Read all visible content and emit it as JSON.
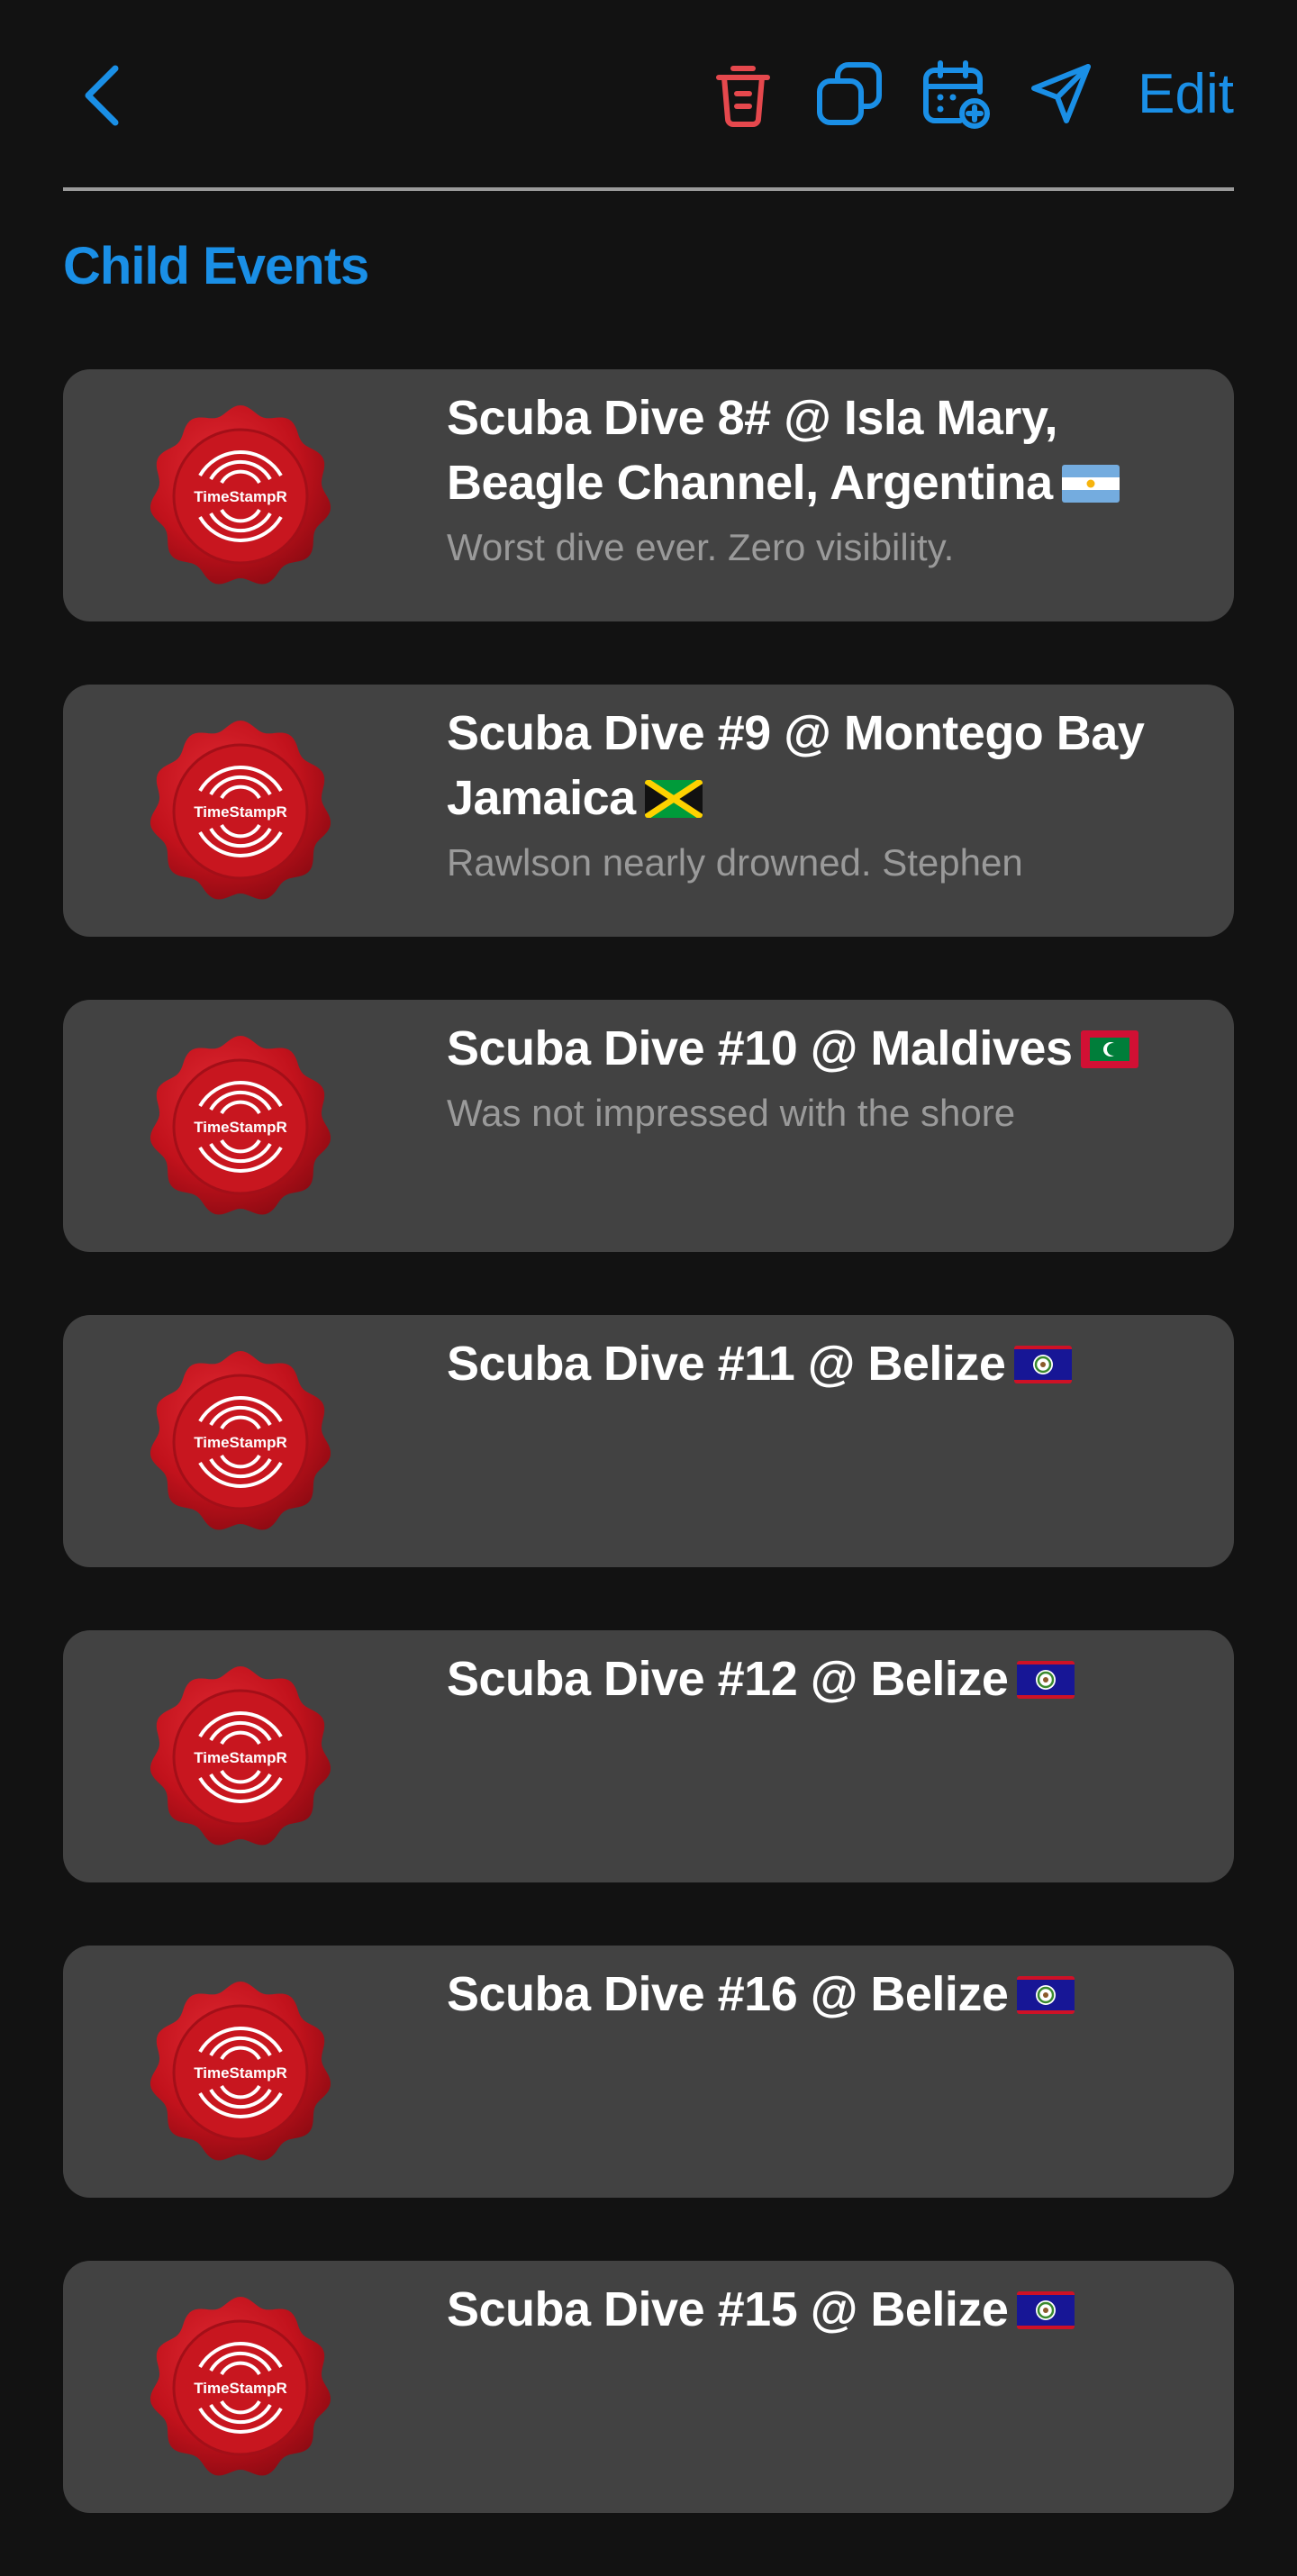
{
  "header": {
    "back_icon": "chevron-left-icon",
    "delete_icon": "trash-icon",
    "duplicate_icon": "copy-icon",
    "add_calendar_icon": "calendar-add-icon",
    "share_icon": "send-icon",
    "edit_label": "Edit",
    "accent_color": "#1a8fe6",
    "delete_color": "#e5484d"
  },
  "section": {
    "title": "Child Events"
  },
  "events": [
    {
      "title": "Scuba Dive 8# @ Isla Mary, Beagle Channel, Argentina",
      "flag": "argentina-flag",
      "note": "Worst dive ever. Zero visibility.",
      "seal_label": "TimeStampR"
    },
    {
      "title": "Scuba Dive #9 @ Montego Bay Jamaica",
      "flag": "jamaica-flag",
      "note": "Rawlson nearly drowned. Stephen",
      "seal_label": "TimeStampR"
    },
    {
      "title": "Scuba Dive #10 @ Maldives",
      "flag": "maldives-flag",
      "note": "Was not impressed with the shore",
      "seal_label": "TimeStampR"
    },
    {
      "title": "Scuba Dive #11 @ Belize",
      "flag": "belize-flag",
      "note": "",
      "seal_label": "TimeStampR"
    },
    {
      "title": "Scuba Dive #12 @ Belize",
      "flag": "belize-flag",
      "note": "",
      "seal_label": "TimeStampR"
    },
    {
      "title": "Scuba Dive #16 @ Belize",
      "flag": "belize-flag",
      "note": "",
      "seal_label": "TimeStampR"
    },
    {
      "title": "Scuba Dive #15 @ Belize",
      "flag": "belize-flag",
      "note": "",
      "seal_label": "TimeStampR"
    }
  ]
}
